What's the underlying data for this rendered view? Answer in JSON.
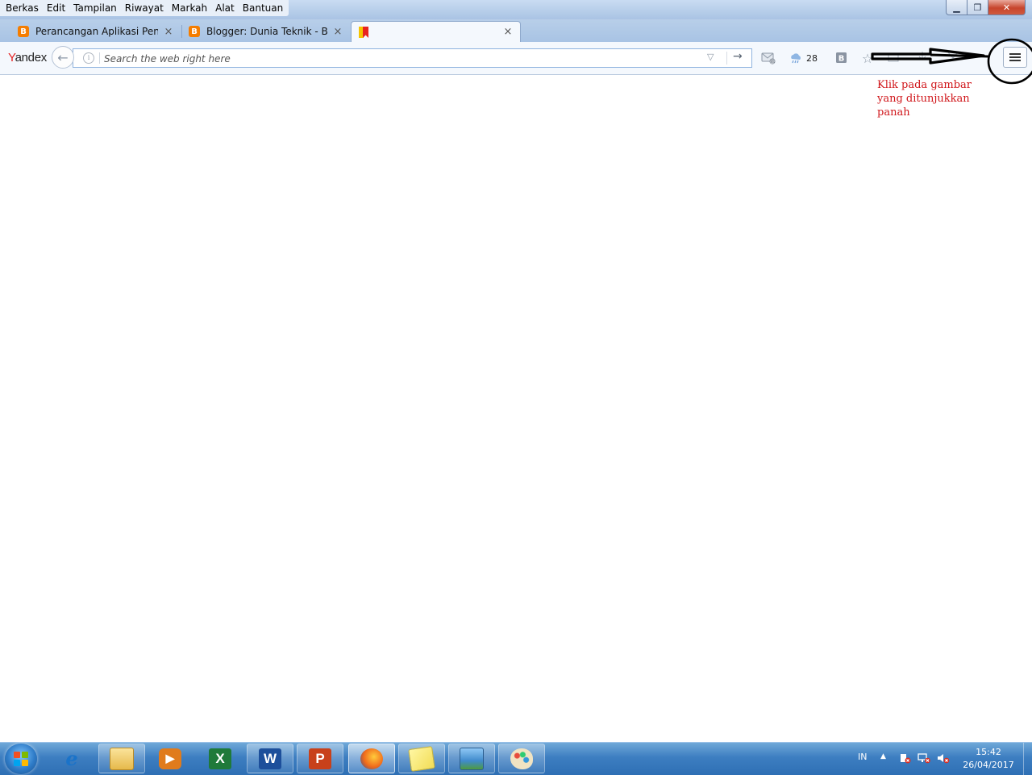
{
  "menu": {
    "items": [
      {
        "label": "Berkas"
      },
      {
        "label": "Edit"
      },
      {
        "label": "Tampilan"
      },
      {
        "label": "Riwayat"
      },
      {
        "label": "Markah"
      },
      {
        "label": "Alat"
      },
      {
        "label": "Bantuan"
      }
    ]
  },
  "window_controls": {
    "minimize": "▁",
    "maximize": "❐",
    "close": "✕"
  },
  "tabs": [
    {
      "label": "Perancangan Aplikasi Peng...",
      "favicon": "blogger-icon",
      "close": "×"
    },
    {
      "label": "Blogger: Dunia Teknik - Bu...",
      "favicon": "blogger-icon",
      "close": "×"
    },
    {
      "label": "",
      "favicon": "yandex-flag-icon",
      "close": "×"
    }
  ],
  "new_tab": "+",
  "navbar": {
    "logo": {
      "first": "Y",
      "rest": "andex"
    },
    "back_icon": "←",
    "search_placeholder": "Search the web right here",
    "go_icon": "→",
    "dropdown_icon": "▽",
    "weather_temp": "28",
    "star_icon": "☆"
  },
  "annotation": {
    "lines": [
      "Klik pada gambar",
      "yang ditunjukkan",
      "panah"
    ],
    "color": "#d0161a"
  },
  "taskbar": {
    "apps": [
      {
        "name": "internet-explorer"
      },
      {
        "name": "windows-explorer"
      },
      {
        "name": "media-player"
      },
      {
        "name": "excel"
      },
      {
        "name": "word"
      },
      {
        "name": "powerpoint"
      },
      {
        "name": "firefox",
        "active": true
      },
      {
        "name": "sticky-notes"
      },
      {
        "name": "photo-viewer"
      },
      {
        "name": "paint"
      }
    ],
    "tray": {
      "lang": "IN",
      "up_arrow": "▲"
    },
    "clock": {
      "time": "15:42",
      "date": "26/04/2017"
    }
  }
}
